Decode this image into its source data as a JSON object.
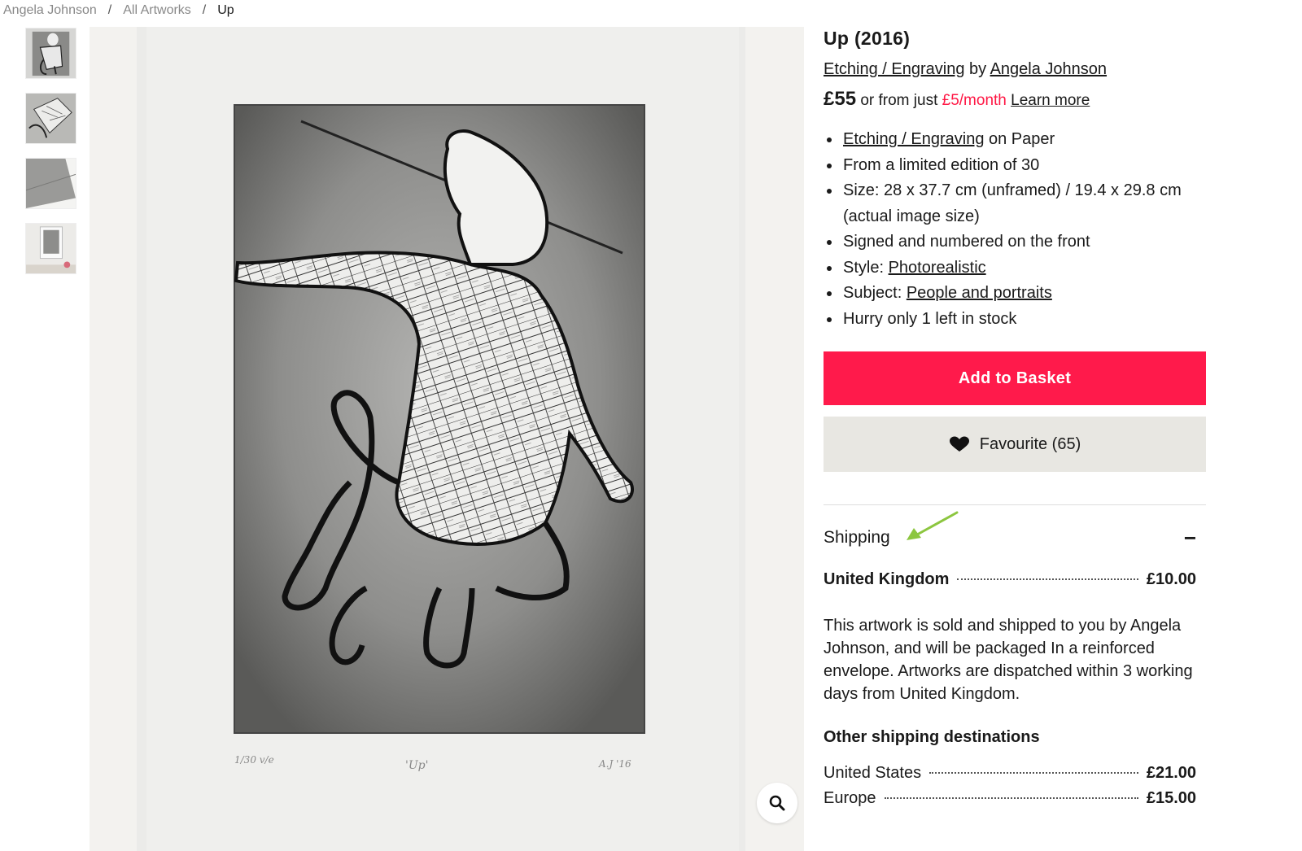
{
  "breadcrumb": {
    "items": [
      "Angela Johnson",
      "All Artworks"
    ],
    "separator": "/",
    "current": "Up"
  },
  "thumbnails": [
    "thumb-1",
    "thumb-2",
    "thumb-3",
    "thumb-4"
  ],
  "artwork": {
    "title": "Up (2016)",
    "medium_link": "Etching / Engraving",
    "by_word": "by",
    "artist_link": "Angela Johnson",
    "price": "£55",
    "price_connector": "or from just",
    "monthly": "£5/month",
    "learn_more": "Learn more",
    "plate_text_left": "1/30 v/e",
    "plate_text_center": "'Up'",
    "plate_text_right": "A.J '16"
  },
  "details": {
    "medium_link": "Etching / Engraving",
    "medium_suffix": " on Paper",
    "edition": "From a limited edition of 30",
    "size": "Size: 28 x 37.7 cm (unframed) / 19.4 x 29.8 cm (actual image size)",
    "signed": "Signed and numbered on the front",
    "style_label": "Style: ",
    "style_link": "Photorealistic",
    "subject_label": "Subject: ",
    "subject_link": "People and portraits",
    "stock": "Hurry only 1 left in stock"
  },
  "buttons": {
    "add_to_basket": "Add to Basket",
    "favourite": "Favourite (65)"
  },
  "shipping": {
    "heading": "Shipping",
    "toggle": "−",
    "home": {
      "country": "United Kingdom",
      "price": "£10.00"
    },
    "description": "This artwork is sold and shipped to you by Angela Johnson, and will be packaged In a reinforced envelope. Artworks are dispatched within 3 working days from United Kingdom.",
    "other_heading": "Other shipping destinations",
    "other": [
      {
        "country": "United States",
        "price": "£21.00"
      },
      {
        "country": "Europe",
        "price": "£15.00"
      }
    ]
  },
  "colors": {
    "accent": "#ff1a4b",
    "monthly": "#ff1744",
    "favourite_bg": "#e8e7e2",
    "annotation_arrow": "#8cc63f"
  },
  "icons": {
    "zoom": "magnifier-icon",
    "favourite": "heart-icon",
    "annotation": "arrow-icon"
  }
}
